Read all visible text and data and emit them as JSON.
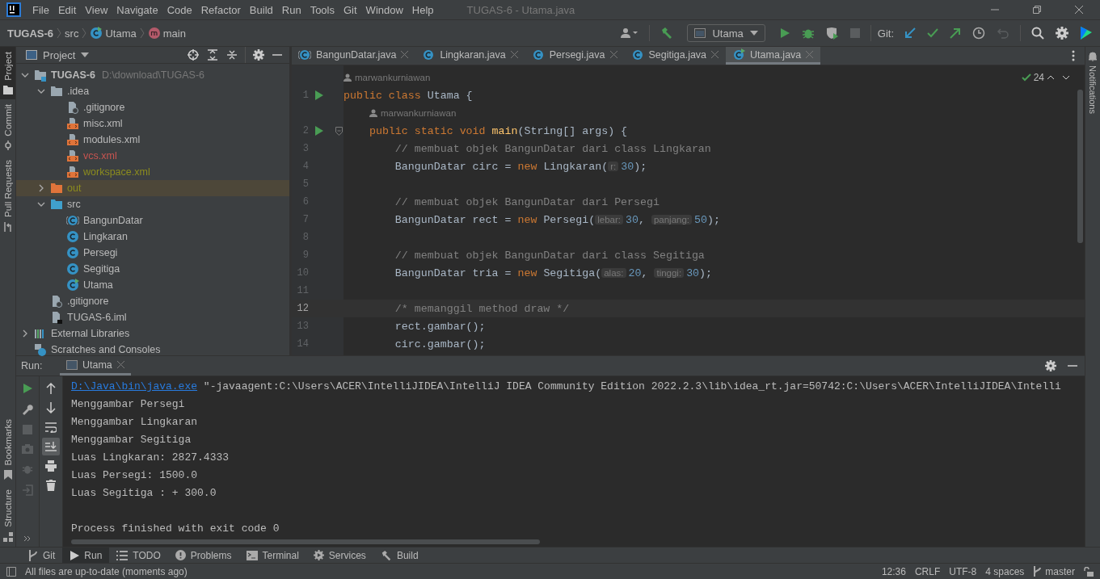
{
  "window": {
    "title": "TUGAS-6 - Utama.java"
  },
  "menu": [
    "File",
    "Edit",
    "View",
    "Navigate",
    "Code",
    "Refactor",
    "Build",
    "Run",
    "Tools",
    "Git",
    "Window",
    "Help"
  ],
  "breadcrumb": [
    {
      "label": "TUGAS-6",
      "kind": "project"
    },
    {
      "label": "src",
      "kind": "folder"
    },
    {
      "label": "Utama",
      "kind": "runnable-class"
    },
    {
      "label": "main",
      "kind": "method"
    }
  ],
  "toolbar": {
    "run_config": "Utama",
    "git_label": "Git:"
  },
  "left_stripe": [
    {
      "label": "Project",
      "selected": true,
      "kind": "folder"
    },
    {
      "label": "Commit",
      "selected": false,
      "kind": "commit"
    },
    {
      "label": "Pull Requests",
      "selected": false,
      "kind": "pull"
    }
  ],
  "left_stripe_bottom": [
    {
      "label": "Bookmarks",
      "kind": "bookmark"
    },
    {
      "label": "Structure",
      "kind": "structure"
    }
  ],
  "right_stripe": [
    "Notifications"
  ],
  "project": {
    "title": "Project",
    "tree": [
      {
        "name": "TUGAS-6",
        "path": "D:\\download\\TUGAS-6",
        "kind": "module",
        "expanded": true,
        "selected": false,
        "children": [
          {
            "name": ".idea",
            "kind": "folder",
            "expanded": true,
            "selected": false,
            "children": [
              {
                "name": ".gitignore",
                "kind": "ignore-file",
                "selected": false
              },
              {
                "name": "misc.xml",
                "kind": "xml",
                "selected": false
              },
              {
                "name": "modules.xml",
                "kind": "xml",
                "selected": false
              },
              {
                "name": "vcs.xml",
                "kind": "xml",
                "selected": false,
                "color": "#c75450"
              },
              {
                "name": "workspace.xml",
                "kind": "xml",
                "selected": false,
                "color": "#8c8c1e"
              }
            ]
          },
          {
            "name": "out",
            "kind": "folder-excluded",
            "expanded": false,
            "selected": true,
            "color": "#8c8c1e"
          },
          {
            "name": "src",
            "kind": "folder-source",
            "expanded": true,
            "selected": false,
            "children": [
              {
                "name": "BangunDatar",
                "kind": "abstract-class",
                "selected": false
              },
              {
                "name": "Lingkaran",
                "kind": "class",
                "selected": false
              },
              {
                "name": "Persegi",
                "kind": "class",
                "selected": false
              },
              {
                "name": "Segitiga",
                "kind": "class",
                "selected": false
              },
              {
                "name": "Utama",
                "kind": "runnable-class",
                "selected": false
              }
            ]
          },
          {
            "name": ".gitignore",
            "kind": "ignore-file",
            "selected": false
          },
          {
            "name": "TUGAS-6.iml",
            "kind": "iml",
            "selected": false
          }
        ]
      },
      {
        "name": "External Libraries",
        "kind": "libraries",
        "expanded": false,
        "selected": false
      },
      {
        "name": "Scratches and Consoles",
        "kind": "scratches",
        "selected": false
      }
    ]
  },
  "editor": {
    "tabs": [
      {
        "label": "BangunDatar.java",
        "kind": "abstract-class",
        "selected": false
      },
      {
        "label": "Lingkaran.java",
        "kind": "class",
        "selected": false
      },
      {
        "label": "Persegi.java",
        "kind": "class",
        "selected": false
      },
      {
        "label": "Segitiga.java",
        "kind": "class",
        "selected": false
      },
      {
        "label": "Utama.java",
        "kind": "runnable-class",
        "selected": true
      }
    ],
    "inspections": "24",
    "lines": [
      {
        "number": "1",
        "author": "marwankurniawan",
        "run": true,
        "current": false,
        "tokens": [
          {
            "t": "public class ",
            "kind": "kw"
          },
          {
            "t": "Utama {",
            "kind": "plain"
          }
        ]
      },
      {
        "number": "2",
        "author": "marwankurniawan",
        "run": true,
        "fold": true,
        "current": false,
        "tokens": [
          {
            "t": "    public static void ",
            "kind": "kw"
          },
          {
            "t": "main",
            "kind": "fn"
          },
          {
            "t": "(String[] args) {",
            "kind": "plain"
          }
        ]
      },
      {
        "number": "3",
        "current": false,
        "tokens": [
          {
            "t": "        // membuat objek BangunDatar dari class Lingkaran",
            "kind": "comment"
          }
        ]
      },
      {
        "number": "4",
        "current": false,
        "tokens": [
          {
            "t": "        BangunDatar circ = ",
            "kind": "plain"
          },
          {
            "t": "new ",
            "kind": "kw"
          },
          {
            "t": "Lingkaran(",
            "kind": "plain"
          },
          {
            "t": "r:",
            "kind": "hint"
          },
          {
            "t": "30",
            "kind": "num"
          },
          {
            "t": ");",
            "kind": "plain"
          }
        ]
      },
      {
        "number": "5",
        "current": false
      },
      {
        "number": "6",
        "current": false,
        "tokens": [
          {
            "t": "        // membuat objek BangunDatar dari Persegi",
            "kind": "comment"
          }
        ]
      },
      {
        "number": "7",
        "current": false,
        "tokens": [
          {
            "t": "        BangunDatar rect = ",
            "kind": "plain"
          },
          {
            "t": "new ",
            "kind": "kw"
          },
          {
            "t": "Persegi(",
            "kind": "plain"
          },
          {
            "t": "lebar:",
            "kind": "hint"
          },
          {
            "t": "30",
            "kind": "num"
          },
          {
            "t": ", ",
            "kind": "plain"
          },
          {
            "t": "panjang:",
            "kind": "hint"
          },
          {
            "t": "50",
            "kind": "num"
          },
          {
            "t": ");",
            "kind": "plain"
          }
        ]
      },
      {
        "number": "8",
        "current": false
      },
      {
        "number": "9",
        "current": false,
        "tokens": [
          {
            "t": "        // membuat objek BangunDatar dari class Segitiga",
            "kind": "comment"
          }
        ]
      },
      {
        "number": "10",
        "current": false,
        "tokens": [
          {
            "t": "        BangunDatar tria = ",
            "kind": "plain"
          },
          {
            "t": "new ",
            "kind": "kw"
          },
          {
            "t": "Segitiga(",
            "kind": "plain"
          },
          {
            "t": "alas:",
            "kind": "hint"
          },
          {
            "t": "20",
            "kind": "num"
          },
          {
            "t": ", ",
            "kind": "plain"
          },
          {
            "t": "tinggi:",
            "kind": "hint"
          },
          {
            "t": "30",
            "kind": "num"
          },
          {
            "t": ");",
            "kind": "plain"
          }
        ]
      },
      {
        "number": "11",
        "current": false
      },
      {
        "number": "12",
        "current": true,
        "tokens": [
          {
            "t": "        /* memanggil method draw */",
            "kind": "comment"
          }
        ]
      },
      {
        "number": "13",
        "current": false,
        "tokens": [
          {
            "t": "        rect.gambar();",
            "kind": "plain"
          }
        ]
      },
      {
        "number": "14",
        "current": false,
        "tokens": [
          {
            "t": "        circ.gambar();",
            "kind": "plain"
          }
        ]
      }
    ]
  },
  "run": {
    "label": "Run:",
    "tabs": [
      {
        "label": "Utama",
        "selected": true
      }
    ],
    "console": [
      {
        "kind": "command",
        "link": "D:\\Java\\bin\\java.exe",
        "text": " \"-javaagent:C:\\Users\\ACER\\IntelliJIDEA\\IntelliJ IDEA Community Edition 2022.2.3\\lib\\idea_rt.jar=50742:C:\\Users\\ACER\\IntelliJIDEA\\Intelli"
      },
      {
        "kind": "output",
        "text": "Menggambar Persegi"
      },
      {
        "kind": "output",
        "text": "Menggambar Lingkaran"
      },
      {
        "kind": "output",
        "text": "Menggambar Segitiga"
      },
      {
        "kind": "output",
        "text": "Luas Lingkaran: 2827.4333"
      },
      {
        "kind": "output",
        "text": "Luas Persegi: 1500.0"
      },
      {
        "kind": "output",
        "text": "Luas Segitiga : + 300.0"
      },
      {
        "kind": "blank"
      },
      {
        "kind": "output",
        "text": "Process finished with exit code 0"
      }
    ]
  },
  "tool_windows": [
    {
      "label": "Git",
      "kind": "git",
      "selected": false
    },
    {
      "label": "Run",
      "kind": "run",
      "selected": true
    },
    {
      "label": "TODO",
      "kind": "todo",
      "selected": false
    },
    {
      "label": "Problems",
      "kind": "problems",
      "selected": false
    },
    {
      "label": "Terminal",
      "kind": "terminal",
      "selected": false
    },
    {
      "label": "Services",
      "kind": "services",
      "selected": false
    },
    {
      "label": "Build",
      "kind": "build",
      "selected": false
    }
  ],
  "status_bar": {
    "message": "All files are up-to-date (moments ago)",
    "items": [
      "12:36",
      "CRLF",
      "UTF-8",
      "4 spaces"
    ],
    "branch": "master"
  }
}
